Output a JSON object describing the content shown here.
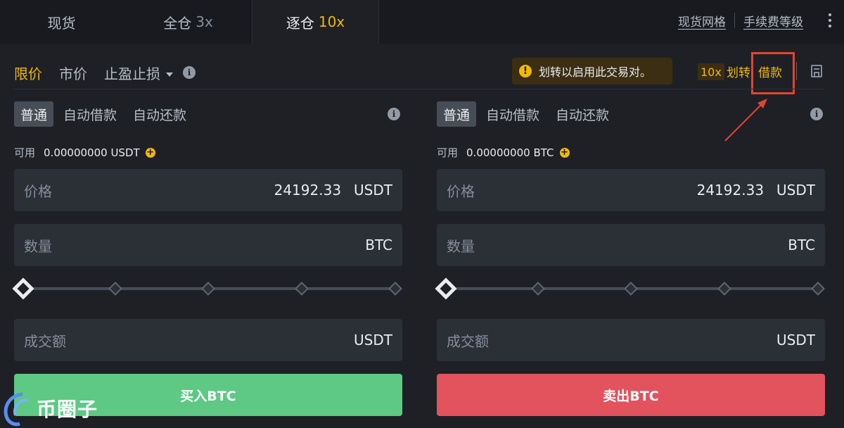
{
  "tabs": [
    {
      "label": "现货",
      "leverage": ""
    },
    {
      "label": "全仓",
      "leverage": "3x"
    },
    {
      "label": "逐仓",
      "leverage": "10x",
      "active": true
    }
  ],
  "top_links": {
    "grid": "现货网格",
    "fee_tier": "手续费等级"
  },
  "order_types": {
    "limit": "限价",
    "market": "市价",
    "stop": "止盈止损"
  },
  "warning": "划转以启用此交易对。",
  "margin_actions": {
    "leverage": "10x",
    "transfer": "划转",
    "borrow": "借款"
  },
  "colors": {
    "accent": "#f0b90b",
    "buy": "#5dc984",
    "sell": "#e2535d",
    "highlight": "#e2452f"
  },
  "buy_panel": {
    "modes": [
      "普通",
      "自动借款",
      "自动还款"
    ],
    "available_label": "可用",
    "available_value": "0.00000000 USDT",
    "price_label": "价格",
    "price_value": "24192.33",
    "price_unit": "USDT",
    "amount_label": "数量",
    "amount_unit": "BTC",
    "total_label": "成交额",
    "total_unit": "USDT",
    "slider_percent": 0,
    "button": "买入BTC"
  },
  "sell_panel": {
    "modes": [
      "普通",
      "自动借款",
      "自动还款"
    ],
    "available_label": "可用",
    "available_value": "0.00000000 BTC",
    "price_label": "价格",
    "price_value": "24192.33",
    "price_unit": "USDT",
    "amount_label": "数量",
    "amount_unit": "BTC",
    "total_label": "成交额",
    "total_unit": "USDT",
    "slider_percent": 0,
    "button": "卖出BTC"
  },
  "watermark": {
    "text": "币圈子"
  }
}
